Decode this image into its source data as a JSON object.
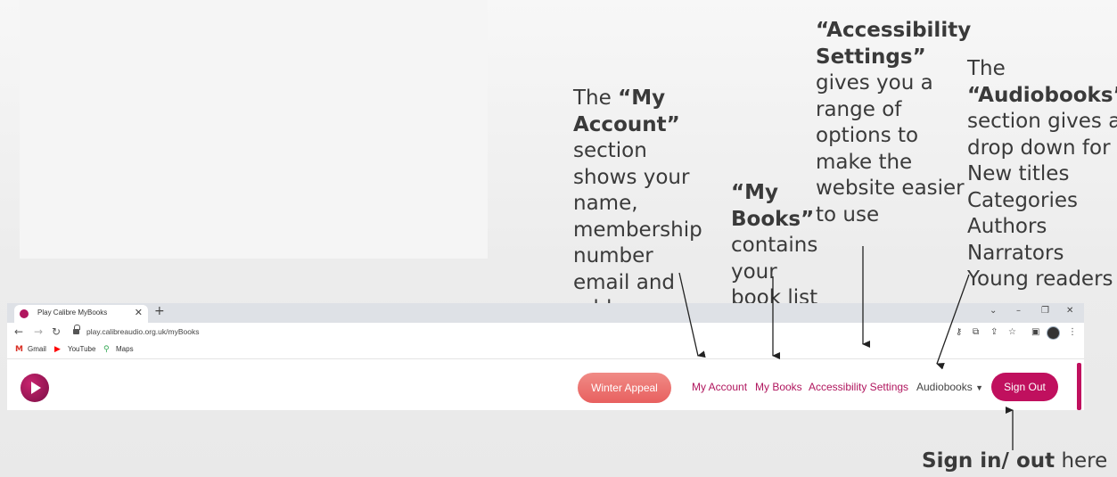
{
  "annotations": {
    "my_account": {
      "pre": "The ",
      "bold1": "“My",
      "bold2": "Account”",
      "lines": [
        "section",
        "shows your",
        "name,",
        "membership",
        "number",
        "email and",
        "address"
      ]
    },
    "my_books": {
      "bold1": "“My",
      "bold2": "Books”",
      "lines": [
        "contains",
        "your",
        "book list"
      ]
    },
    "accessibility": {
      "bold1": "“Accessibility",
      "bold2": "Settings”",
      "lines": [
        "gives you a",
        "range of",
        "options to",
        "make the",
        "website easier",
        "to use"
      ]
    },
    "audiobooks": {
      "pre": "The",
      "bold": "“Audiobooks”",
      "lines": [
        "section gives a",
        "drop down for",
        "New titles",
        "Categories",
        "Authors",
        "Narrators",
        "Young readers"
      ]
    },
    "signin": {
      "bold": "Sign in/ out",
      "rest": " here"
    }
  },
  "browser": {
    "tab_title": "Play Calibre MyBooks",
    "tab_close": "✕",
    "new_tab": "+",
    "url": "play.calibreaudio.org.uk/myBooks",
    "bookmarks": [
      "Gmail",
      "YouTube",
      "Maps"
    ]
  },
  "site": {
    "winter_appeal": "Winter Appeal",
    "my_account": "My Account",
    "my_books": "My Books",
    "accessibility_settings": "Accessibility Settings",
    "audiobooks": "Audiobooks",
    "sign_out": "Sign Out"
  },
  "colors": {
    "brand": "#c0105e",
    "appeal": "#e8605f"
  }
}
